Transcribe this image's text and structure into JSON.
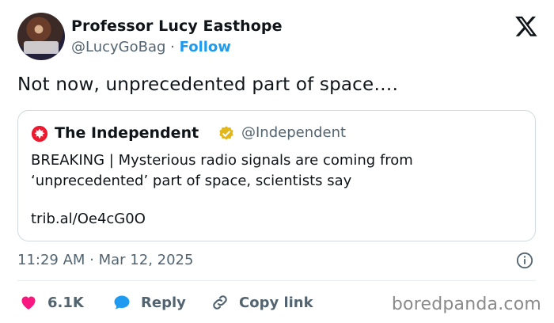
{
  "author": {
    "name": "Professor Lucy Easthope",
    "handle": "@LucyGoBag",
    "separator": "·",
    "follow_label": "Follow"
  },
  "tweet": {
    "text": "Not now, unprecedented part of space…."
  },
  "quoted": {
    "name": "The Independent",
    "handle": "@Independent",
    "line1": "BREAKING | Mysterious radio signals are coming from",
    "line2": "‘unprecedented’ part of space, scientists say",
    "link": "trib.al/Oe4cG0O",
    "verified": true
  },
  "meta": {
    "timestamp": "11:29 AM · Mar 12, 2025"
  },
  "actions": {
    "like_count": "6.1K",
    "reply_label": "Reply",
    "copy_label": "Copy link"
  },
  "watermark": "boredpanda.com",
  "colors": {
    "accent": "#1d9bf0",
    "like": "#f91880",
    "verified": "#e2b719",
    "independent_red": "#ec1a2e",
    "muted": "#536471"
  },
  "icons": [
    "x-logo-icon",
    "independent-eagle-icon",
    "verified-badge-icon",
    "info-icon",
    "heart-icon",
    "reply-bubble-icon",
    "link-icon"
  ]
}
